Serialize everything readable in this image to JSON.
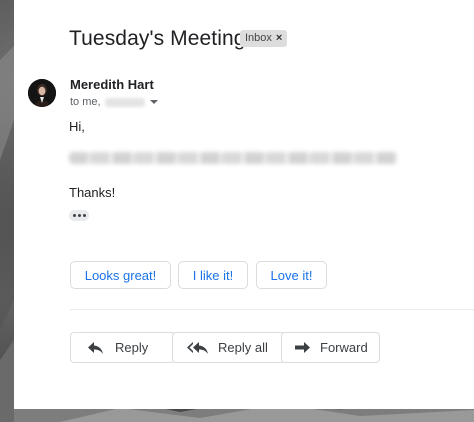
{
  "email": {
    "subject": "Tuesday's Meeting",
    "label": "Inbox",
    "label_remove": "×",
    "sender_name": "Meredith Hart",
    "to_prefix": "to me,",
    "greeting": "Hi,",
    "signoff": "Thanks!"
  },
  "smart_replies": [
    "Looks great!",
    "I like it!",
    "Love it!"
  ],
  "actions": {
    "reply": "Reply",
    "reply_all": "Reply all",
    "forward": "Forward"
  },
  "icons": {
    "reply": "reply-icon",
    "reply_all": "reply-all-icon",
    "forward": "forward-icon",
    "more": "more-icon",
    "caret": "chevron-down-icon"
  }
}
